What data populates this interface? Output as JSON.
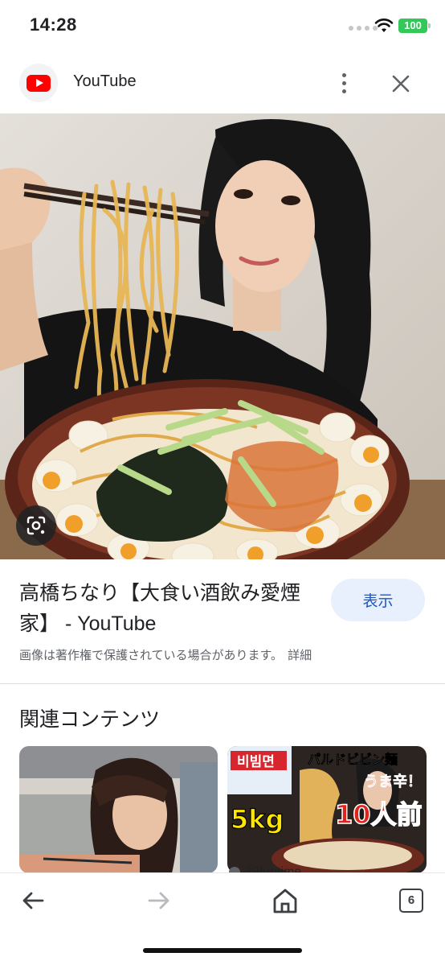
{
  "status_bar": {
    "time": "14:28",
    "battery": "100"
  },
  "header": {
    "site_name": "YouTube"
  },
  "icons": [
    "youtube-logo-icon",
    "more-vert-icon",
    "close-icon",
    "google-lens-icon",
    "back-arrow-icon",
    "forward-arrow-icon",
    "home-icon",
    "tabs-icon"
  ],
  "result": {
    "title": "高橋ちなり【大食い酒飲み愛煙家】 - YouTube",
    "view_button": "表示",
    "copyright_notice": "画像は著作権で保護されている場合があります。",
    "details_link": "詳細"
  },
  "related": {
    "heading": "関連コンテンツ",
    "items": [
      {
        "source": ""
      },
      {
        "source": "39funtime",
        "overlay_texts": [
          "비빔면",
          "パルドビビン麺",
          "うま辛！",
          "5kg",
          "10人前"
        ]
      }
    ]
  },
  "toolbar": {
    "tab_count": "6"
  },
  "colors": {
    "accent_blue": "#1a56c4",
    "view_button_bg": "#e8f0fe",
    "battery_green": "#34c759",
    "youtube_red": "#ff0000"
  }
}
